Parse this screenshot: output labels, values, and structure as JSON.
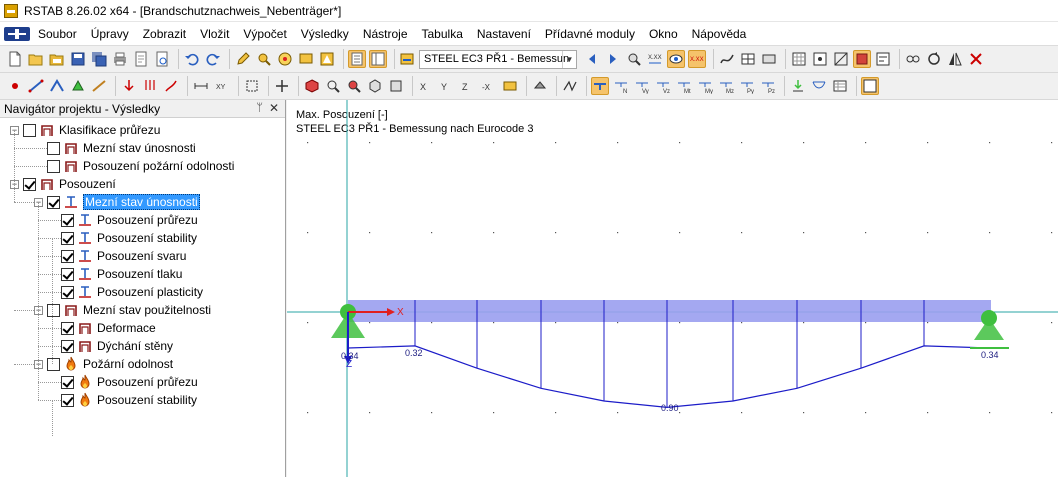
{
  "window": {
    "title": "RSTAB 8.26.02 x64 - [Brandschutznachweis_Nebenträger*]"
  },
  "menu": {
    "items": [
      "Soubor",
      "Úpravy",
      "Zobrazit",
      "Vložit",
      "Výpočet",
      "Výsledky",
      "Nástroje",
      "Tabulka",
      "Nastavení",
      "Přídavné moduly",
      "Okno",
      "Nápověda"
    ]
  },
  "toolbar": {
    "design_case_combo": "STEEL EC3 PŘ1 - Bemessun",
    "load_buttons": [
      "N",
      "Vy",
      "Vz",
      "Mt",
      "My",
      "Mz",
      "Py",
      "Pz"
    ]
  },
  "navigator": {
    "title": "Navigátor projektu - Výsledky",
    "pin_icon": "pin-icon",
    "close_icon": "close-icon",
    "tree": [
      {
        "label": "Klasifikace průřezu",
        "level": 0,
        "expander": "-",
        "checked": false,
        "icon": "section-icon"
      },
      {
        "label": "Mezní stav únosnosti",
        "level": 1,
        "checked": false,
        "icon": "section-icon"
      },
      {
        "label": "Posouzení požární odolnosti",
        "level": 1,
        "checked": false,
        "icon": "section-icon"
      },
      {
        "label": "Posouzení",
        "level": 0,
        "expander": "-",
        "checked": true,
        "icon": "section-icon"
      },
      {
        "label": "Mezní stav únosnosti",
        "level": 1,
        "expander": "-",
        "checked": true,
        "icon": "beam-icon",
        "selected": true
      },
      {
        "label": "Posouzení průřezu",
        "level": 2,
        "checked": true,
        "icon": "beam-icon"
      },
      {
        "label": "Posouzení stability",
        "level": 2,
        "checked": true,
        "icon": "beam-icon"
      },
      {
        "label": "Posouzení svaru",
        "level": 2,
        "checked": true,
        "icon": "beam-icon"
      },
      {
        "label": "Posouzení tlaku",
        "level": 2,
        "checked": true,
        "icon": "beam-icon"
      },
      {
        "label": "Posouzení plasticity",
        "level": 2,
        "checked": true,
        "icon": "beam-icon"
      },
      {
        "label": "Mezní stav použitelnosti",
        "level": 1,
        "expander": "-",
        "checked": false,
        "icon": "section-icon"
      },
      {
        "label": "Deformace",
        "level": 2,
        "checked": true,
        "icon": "section-icon"
      },
      {
        "label": "Dýchání stěny",
        "level": 2,
        "checked": true,
        "icon": "section-icon"
      },
      {
        "label": "Požární odolnost",
        "level": 1,
        "expander": "-",
        "checked": false,
        "icon": "fire-icon"
      },
      {
        "label": "Posouzení průřezu",
        "level": 2,
        "checked": true,
        "icon": "fire-icon"
      },
      {
        "label": "Posouzení stability",
        "level": 2,
        "checked": true,
        "icon": "fire-icon"
      }
    ]
  },
  "canvas": {
    "info_line1": "Max. Posouzení [-]",
    "info_line2": "STEEL EC3 PŘ1 - Bemessung nach Eurocode 3",
    "axis_x_label": "X",
    "axis_z_label": "Z",
    "result_labels": [
      "0.34",
      "0.32",
      "0.90",
      "0.34"
    ],
    "diagram_profile": [
      0.34,
      0.32,
      0.53,
      0.72,
      0.84,
      0.9,
      0.84,
      0.72,
      0.53,
      0.32,
      0.34
    ],
    "colors": {
      "beam": "#9a9ef0",
      "diagram": "#1c1cc8",
      "support": "#3fbf3f",
      "axis": "#2aa6a6"
    }
  }
}
